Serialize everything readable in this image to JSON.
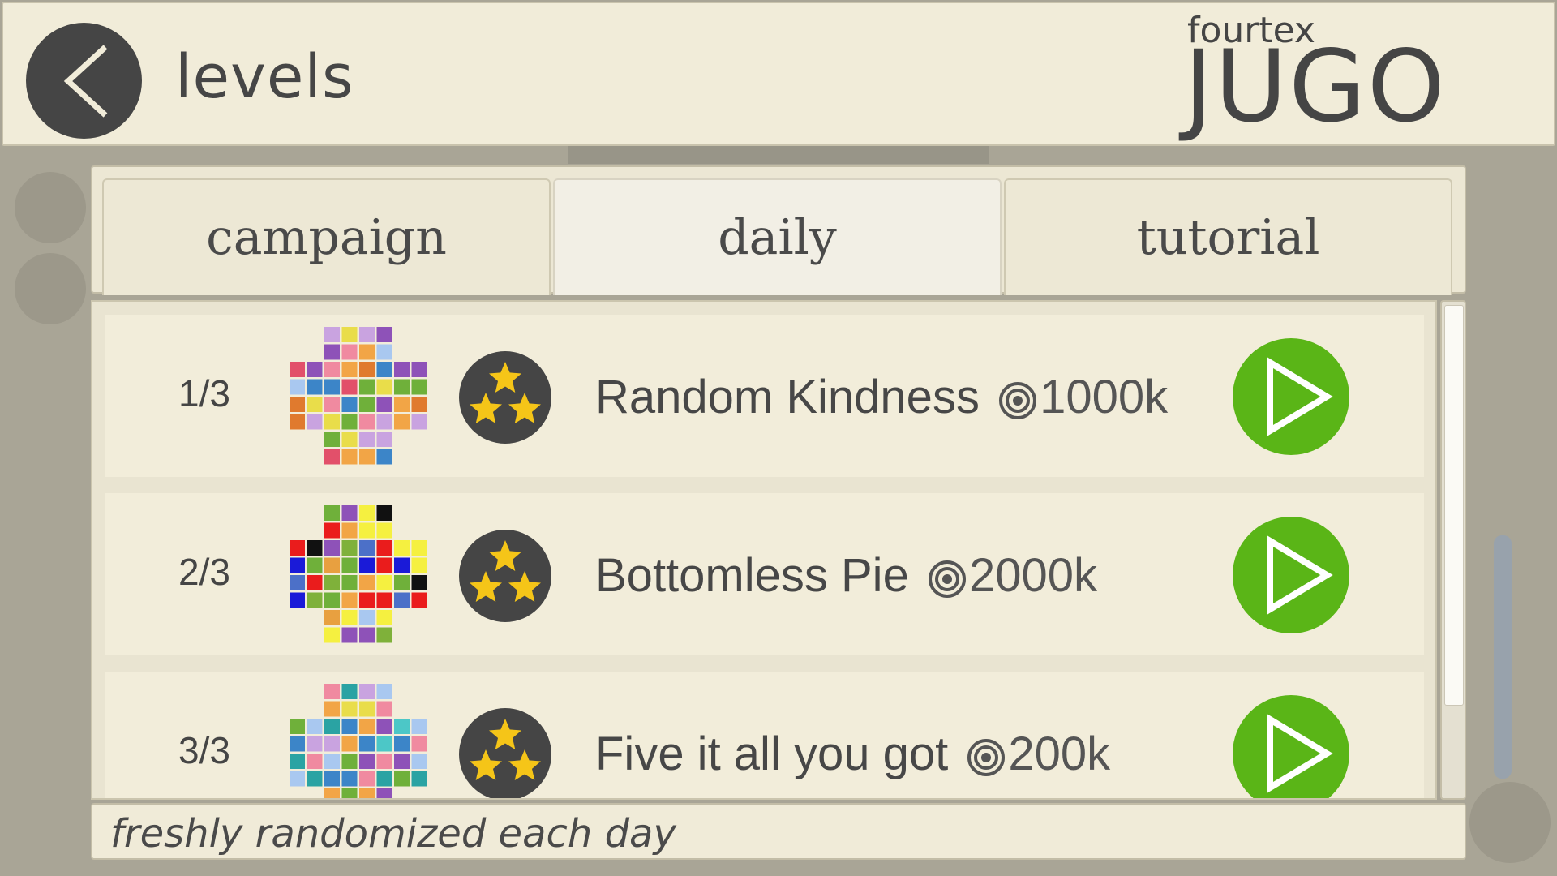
{
  "header": {
    "title": "levels",
    "brand_small": "fourtex",
    "brand_big": "JUGO"
  },
  "tabs": [
    {
      "label": "campaign",
      "active": false
    },
    {
      "label": "daily",
      "active": true
    },
    {
      "label": "tutorial",
      "active": false
    }
  ],
  "levels": [
    {
      "index": "1/3",
      "name": "Random Kindness",
      "score": "1000k",
      "stars": 3,
      "icon": "puzzle-thumbnail"
    },
    {
      "index": "2/3",
      "name": "Bottomless Pie",
      "score": "2000k",
      "stars": 3,
      "icon": "puzzle-thumbnail"
    },
    {
      "index": "3/3",
      "name": "Five it all you got",
      "score": "200k",
      "stars": 3,
      "icon": "puzzle-thumbnail"
    }
  ],
  "footer": {
    "text": "freshly randomized each day"
  },
  "colors": {
    "play": "#5ab517",
    "star": "#f5c518",
    "dark": "#454545",
    "cream": "#f2edda"
  }
}
